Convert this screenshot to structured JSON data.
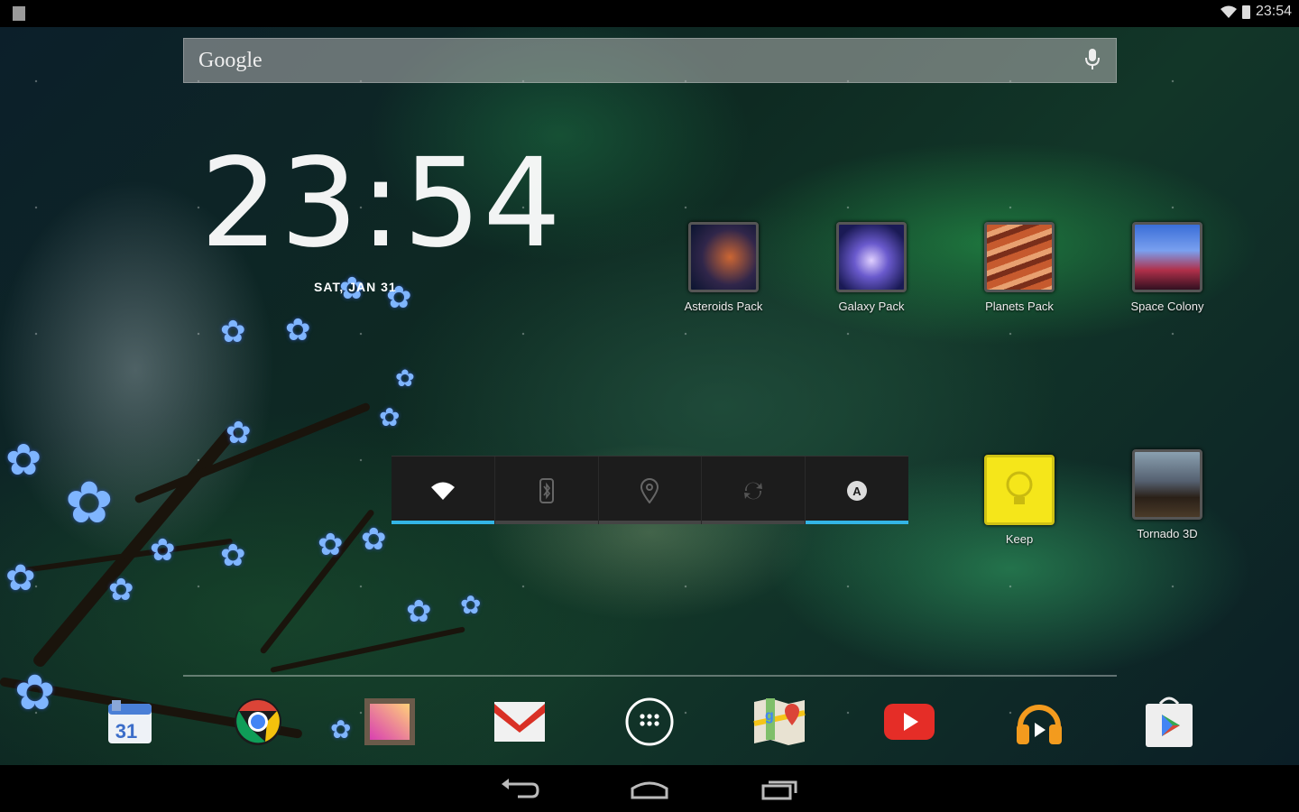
{
  "status_bar": {
    "time": "23:54"
  },
  "search": {
    "label": "Google"
  },
  "clock": {
    "time": "23:54",
    "date": "SAT, JAN 31"
  },
  "desktop_apps": [
    {
      "label": "Asteroids Pack",
      "icon": "asteroid-icon"
    },
    {
      "label": "Galaxy Pack",
      "icon": "galaxy-icon"
    },
    {
      "label": "Planets Pack",
      "icon": "planet-icon"
    },
    {
      "label": "Space Colony",
      "icon": "city-icon"
    },
    {
      "label": "Keep",
      "icon": "lightbulb-icon"
    },
    {
      "label": "Tornado 3D",
      "icon": "tornado-icon"
    }
  ],
  "power_widget": {
    "toggles": [
      {
        "name": "wifi",
        "on": true
      },
      {
        "name": "bluetooth",
        "on": false
      },
      {
        "name": "location",
        "on": false
      },
      {
        "name": "sync",
        "on": false
      },
      {
        "name": "brightness",
        "on": true
      }
    ],
    "accent": "#33b5e5"
  },
  "dock": [
    {
      "name": "calendar",
      "text": "31"
    },
    {
      "name": "chrome"
    },
    {
      "name": "gallery"
    },
    {
      "name": "gmail"
    },
    {
      "name": "all-apps"
    },
    {
      "name": "maps"
    },
    {
      "name": "youtube"
    },
    {
      "name": "play-music"
    },
    {
      "name": "play-store"
    }
  ]
}
